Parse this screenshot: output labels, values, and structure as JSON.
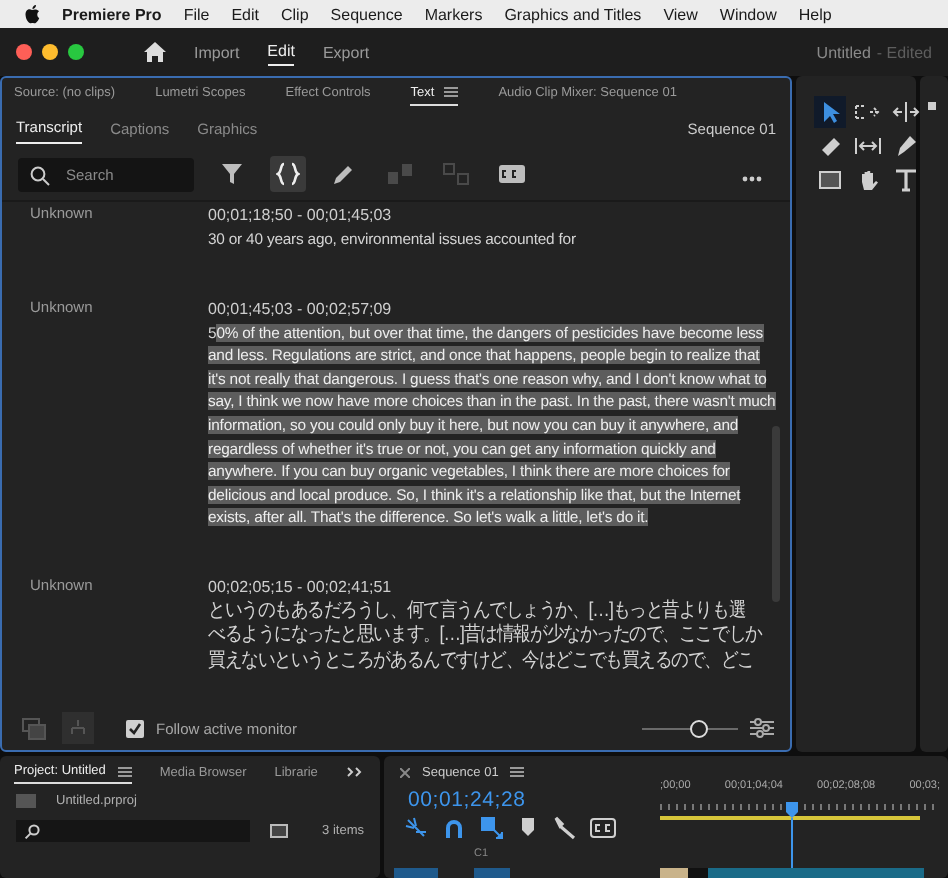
{
  "menu_bar": {
    "app": "Premiere Pro",
    "items": [
      "File",
      "Edit",
      "Clip",
      "Sequence",
      "Markers",
      "Graphics and Titles",
      "View",
      "Window",
      "Help"
    ]
  },
  "title_bar": {
    "workspaces": [
      {
        "label": "Import",
        "selected": false
      },
      {
        "label": "Edit",
        "selected": true
      },
      {
        "label": "Export",
        "selected": false
      }
    ],
    "document": "Untitled",
    "status": "- Edited"
  },
  "text_panel": {
    "tabs": [
      {
        "label": "Source: (no clips)",
        "selected": false
      },
      {
        "label": "Lumetri Scopes",
        "selected": false
      },
      {
        "label": "Effect Controls",
        "selected": false
      },
      {
        "label": "Text",
        "selected": true
      },
      {
        "label": "Audio Clip Mixer: Sequence 01",
        "selected": false
      }
    ],
    "subtabs": [
      {
        "label": "Transcript",
        "selected": true
      },
      {
        "label": "Captions",
        "selected": false
      },
      {
        "label": "Graphics",
        "selected": false
      }
    ],
    "sequence": "Sequence 01",
    "search": {
      "placeholder": "Search"
    },
    "tools": [
      {
        "kind": "filter",
        "on": false,
        "disabled": false
      },
      {
        "kind": "braces",
        "on": true,
        "disabled": false
      },
      {
        "kind": "pencil",
        "on": false,
        "disabled": false
      },
      {
        "kind": "merge",
        "on": false,
        "disabled": true
      },
      {
        "kind": "split",
        "on": false,
        "disabled": true
      },
      {
        "kind": "captions",
        "on": false,
        "disabled": false
      }
    ],
    "segments": [
      {
        "speaker": "Unknown",
        "time": "00;01;18;50 - 00;01;45;03",
        "parts": [
          {
            "text": "30 or 40 years ago, environmental issues accounted for",
            "highlighted": false
          }
        ]
      },
      {
        "speaker": "Unknown",
        "time": "00;01;45;03 - 00;02;57;09",
        "parts": [
          {
            "text": "5",
            "highlighted": false
          },
          {
            "text": "0% of the attention, but over that time, the dangers of pesticides have become less and less. Regulations are strict, and once that happens, people begin to realize that it's not really that dangerous. I guess that's one reason why, and I don't know what to say, I think we now have more choices than in the past. In the past, there wasn't much information, so you could only buy it here, but now you can buy it anywhere, and regardless of whether it's true or not, you can get any information quickly and anywhere. If you can buy organic vegetables, I think there are more choices for delicious and local produce. So, I think it's a relationship like that, but the Internet exists, after all. That's the difference. So let's walk a little, let's do it.",
            "highlighted": true
          }
        ]
      },
      {
        "speaker": "Unknown",
        "time": "00;02;05;15 - 00;02;41;51",
        "kind": "lines",
        "parts": [
          {
            "text": "というのもあるだろうし、何て言うんでしょうか、[…]もっと昔よりも選",
            "highlighted": false
          },
          {
            "text": "べるようになったと思います。[…]昔は情報が少なかったので、ここでしか",
            "highlighted": false
          },
          {
            "text": "買えないというところがあるんですけど、今はどこでも買えるので、どこ",
            "highlighted": false
          }
        ]
      }
    ],
    "follow_active_monitor": {
      "label": "Follow active monitor",
      "checked": true
    },
    "zoom": {
      "level": 0.58
    }
  },
  "tools_panel": {
    "tools": [
      {
        "kind": "selection",
        "selected": true
      },
      {
        "kind": "track-select",
        "selected": false
      },
      {
        "kind": "ripple",
        "selected": false
      },
      {
        "kind": "razor",
        "selected": false
      },
      {
        "kind": "slip",
        "selected": false
      },
      {
        "kind": "pen",
        "selected": false
      },
      {
        "kind": "rectangle",
        "selected": false
      },
      {
        "kind": "hand",
        "selected": false
      },
      {
        "kind": "type",
        "selected": false
      }
    ]
  },
  "project_panel": {
    "tabs": [
      {
        "label": "Project: Untitled",
        "selected": true
      },
      {
        "label": "Media Browser",
        "selected": false
      },
      {
        "label": "Librarie",
        "selected": false
      }
    ],
    "file": "Untitled.prproj",
    "item_count": "3 items"
  },
  "timeline": {
    "tab": "Sequence 01",
    "timecode": "00;01;24;28",
    "tools": [
      {
        "kind": "nest",
        "on": true
      },
      {
        "kind": "snap",
        "on": true
      },
      {
        "kind": "linked",
        "on": true
      },
      {
        "kind": "marker",
        "on": false
      },
      {
        "kind": "wrench",
        "on": false
      },
      {
        "kind": "captions",
        "on": false
      }
    ],
    "track_label": "C1",
    "ruler": [
      ";00;00",
      "00;01;04;04",
      "00;02;08;08",
      "00;03;"
    ],
    "playhead": {
      "level": 0.47
    }
  }
}
